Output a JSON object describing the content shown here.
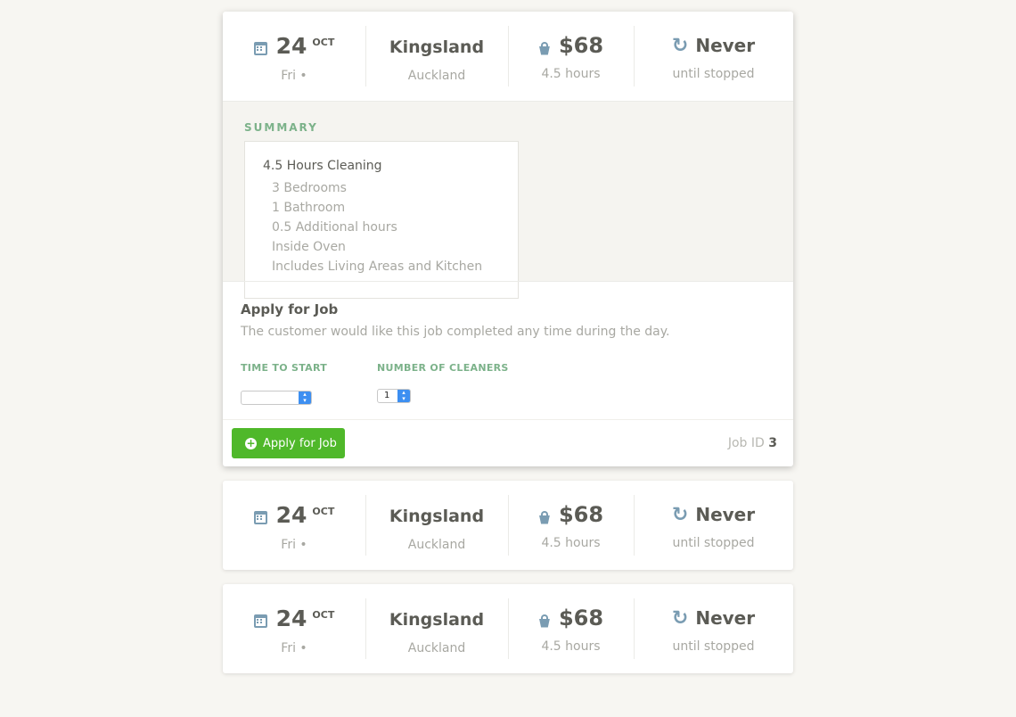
{
  "jobs": [
    {
      "day": "24",
      "month": "OCT",
      "weekday": "Fri •",
      "suburb": "Kingsland",
      "city": "Auckland",
      "price": "$68",
      "duration": "4.5 hours",
      "repeat": "Never",
      "repeat_sub": "until stopped"
    },
    {
      "day": "24",
      "month": "OCT",
      "weekday": "Fri •",
      "suburb": "Kingsland",
      "city": "Auckland",
      "price": "$68",
      "duration": "4.5 hours",
      "repeat": "Never",
      "repeat_sub": "until stopped"
    },
    {
      "day": "24",
      "month": "OCT",
      "weekday": "Fri •",
      "suburb": "Kingsland",
      "city": "Auckland",
      "price": "$68",
      "duration": "4.5 hours",
      "repeat": "Never",
      "repeat_sub": "until stopped"
    }
  ],
  "summary": {
    "title": "SUMMARY",
    "heading": "4.5 Hours Cleaning",
    "items": [
      "3 Bedrooms",
      "1 Bathroom",
      "0.5 Additional hours",
      "Inside Oven",
      "Includes Living Areas and Kitchen"
    ]
  },
  "apply": {
    "title": "Apply for Job",
    "description": "The customer would like this job completed any time during the day.",
    "time_label": "TIME TO START",
    "time_value": "",
    "cleaners_label": "NUMBER OF CLEANERS",
    "cleaners_value": "1",
    "button_label": "Apply for Job",
    "job_id_label": "Job ID",
    "job_id_value": "3"
  },
  "icons": {
    "date": "calendar-icon",
    "price": "bucket-icon",
    "repeat": "repeat-icon",
    "apply": "plus-circle-icon",
    "select": "select-arrows-icon"
  },
  "colors": {
    "accent_green": "#4fb82a",
    "label_green": "#7cb28a",
    "icon_blue": "#7a9cb2",
    "select_blue": "#3d8ff1"
  }
}
